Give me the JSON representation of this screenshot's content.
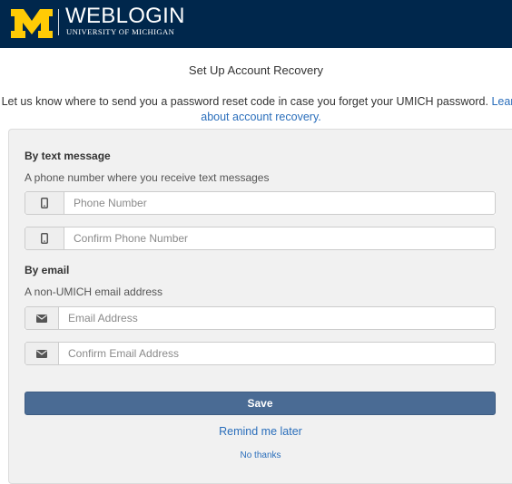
{
  "header": {
    "logo_name": "block-m-icon",
    "title": "WEBLOGIN",
    "subtitle": "UNIVERSITY OF MICHIGAN",
    "background_color": "#00274c",
    "logo_color": "#ffcb05"
  },
  "page": {
    "title": "Set Up Account Recovery",
    "intro_text": "Let us know where to send you a password reset code in case you forget your UMICH password.",
    "learn_more_link": "Learn about account recovery."
  },
  "text_section": {
    "heading": "By text message",
    "help": "A phone number where you receive text messages",
    "phone_placeholder": "Phone Number",
    "confirm_phone_placeholder": "Confirm Phone Number",
    "icon": "mobile-phone-icon"
  },
  "email_section": {
    "heading": "By email",
    "help": "A non-UMICH email address",
    "email_placeholder": "Email Address",
    "confirm_email_placeholder": "Confirm Email Address",
    "icon": "envelope-icon"
  },
  "actions": {
    "save_label": "Save",
    "remind_label": "Remind me later",
    "no_thanks_label": "No thanks",
    "primary_color": "#4a6b94",
    "link_color": "#2a6ebb"
  }
}
